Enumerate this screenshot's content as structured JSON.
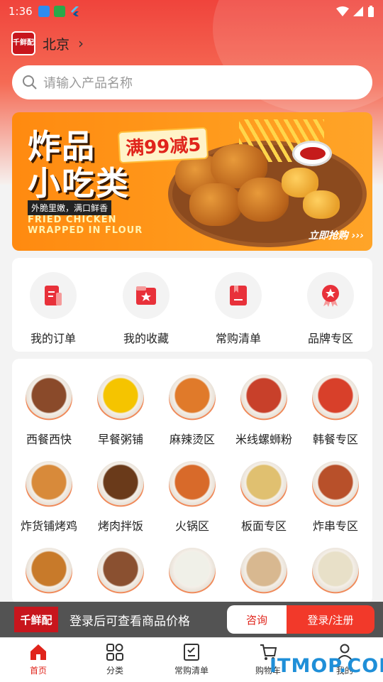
{
  "status_bar": {
    "time": "1:36"
  },
  "location": {
    "logo_text": "千鲜配",
    "city": "北京"
  },
  "search": {
    "placeholder": "请输入产品名称"
  },
  "banner": {
    "title_line1": "炸品",
    "title_line2": "小吃类",
    "coupon": "满99减5",
    "subtitle": "外脆里嫩，满口鲜香",
    "english_line1": "FRIED CHICKEN",
    "english_line2": "WRAPPED IN FLOUR",
    "cta": "立即抢购"
  },
  "quick_links": [
    {
      "label": "我的订单",
      "icon": "order-icon"
    },
    {
      "label": "我的收藏",
      "icon": "favorites-icon"
    },
    {
      "label": "常购清单",
      "icon": "bookmark-icon"
    },
    {
      "label": "品牌专区",
      "icon": "brand-badge-icon"
    }
  ],
  "categories": [
    {
      "label": "西餐西快",
      "color": "#8a4a2a"
    },
    {
      "label": "早餐粥铺",
      "color": "#f5c400"
    },
    {
      "label": "麻辣烫区",
      "color": "#e07a2a"
    },
    {
      "label": "米线螺蛳粉",
      "color": "#c8402a"
    },
    {
      "label": "韩餐专区",
      "color": "#d8402a"
    },
    {
      "label": "炸货铺烤鸡",
      "color": "#d88a3a"
    },
    {
      "label": "烤肉拌饭",
      "color": "#6a3a1a"
    },
    {
      "label": "火锅区",
      "color": "#d86a2a"
    },
    {
      "label": "板面专区",
      "color": "#e0c070"
    },
    {
      "label": "炸串专区",
      "color": "#b8502a"
    },
    {
      "label": "",
      "color": "#c87a2a"
    },
    {
      "label": "",
      "color": "#8a5030"
    },
    {
      "label": "",
      "color": "#f0f0e8"
    },
    {
      "label": "",
      "color": "#d8b890"
    },
    {
      "label": "",
      "color": "#e8e0c8"
    }
  ],
  "login_bar": {
    "logo_text": "千鲜配",
    "message": "登录后可查看商品价格",
    "consult": "咨询",
    "login": "登录/注册"
  },
  "tabs": [
    {
      "label": "首页",
      "active": true
    },
    {
      "label": "分类",
      "active": false
    },
    {
      "label": "常购清单",
      "active": false
    },
    {
      "label": "购物车",
      "active": false
    },
    {
      "label": "我的",
      "active": false
    }
  ],
  "watermark": "ITMOP.COM",
  "colors": {
    "brand_red": "#e0241b",
    "banner_orange": "#ff8a10"
  }
}
